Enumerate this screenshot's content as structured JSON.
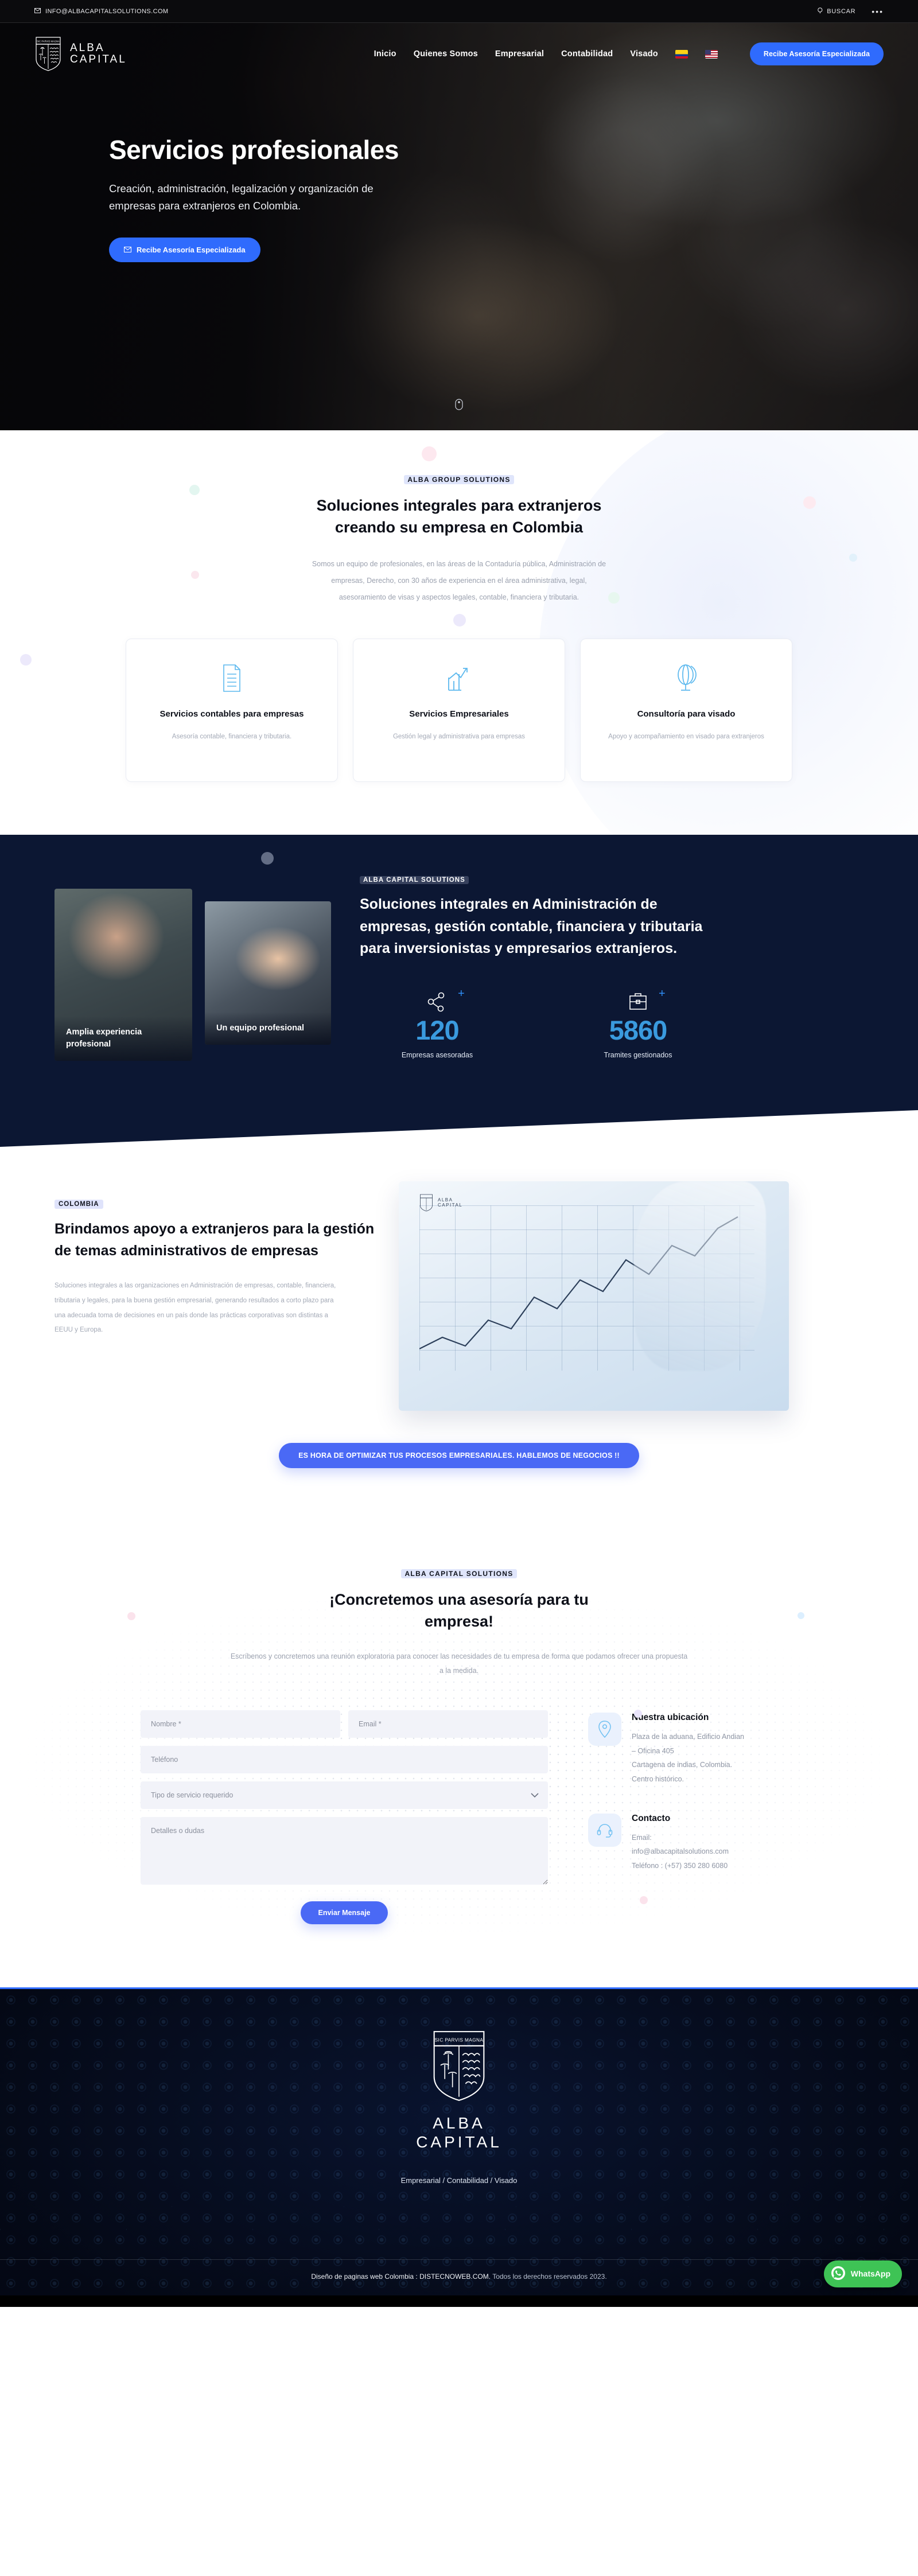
{
  "topbar": {
    "email": "INFO@ALBACAPITALSOLUTIONS.COM",
    "search_label": "BUSCAR",
    "more_label": "•••"
  },
  "brand": {
    "motto": "SIC PARVIS MAGNA",
    "line1": "ALBA",
    "line2": "CAPITAL"
  },
  "nav": {
    "items": [
      {
        "label": "Inicio"
      },
      {
        "label": "Quienes Somos"
      },
      {
        "label": "Empresarial"
      },
      {
        "label": "Contabilidad"
      },
      {
        "label": "Visado"
      }
    ],
    "flags": [
      {
        "name": "colombia-flag"
      },
      {
        "name": "usa-flag"
      }
    ],
    "cta": "Recibe Asesoría Especializada"
  },
  "hero": {
    "title": "Servicios profesionales",
    "subtitle": "Creación, administración, legalización y organización de empresas para extranjeros en Colombia.",
    "button": "Recibe Asesoría Especializada"
  },
  "solutions": {
    "eyebrow": "ALBA GROUP SOLUTIONS",
    "title": "Soluciones integrales para extranjeros creando su empresa en Colombia",
    "body": "Somos un equipo de profesionales, en las áreas de la Contaduría pública, Administración de empresas, Derecho, con 30 años de experiencia en el área administrativa, legal, asesoramiento de visas y aspectos legales, contable, financiera y tributaria.",
    "cards": [
      {
        "icon": "document-icon",
        "title": "Servicios contables para empresas",
        "desc": "Asesoría contable, financiera y tributaria."
      },
      {
        "icon": "bar-chart-growth-icon",
        "title": "Servicios Empresariales",
        "desc": "Gestión legal y administrativa para empresas"
      },
      {
        "icon": "globe-icon",
        "title": "Consultoría para visado",
        "desc": "Apoyo y acompañamiento en visado para extranjeros"
      }
    ]
  },
  "dark": {
    "eyebrow": "ALBA CAPITAL SOLUTIONS",
    "title": "Soluciones integrales en Administración de empresas, gestión contable, financiera y tributaria para inversionistas y empresarios extranjeros.",
    "photos": [
      {
        "caption": "Amplia experiencia profesional"
      },
      {
        "caption": "Un equipo profesional"
      }
    ],
    "stats": [
      {
        "icon": "share-network-icon",
        "plus": "+",
        "value": "120",
        "label": "Empresas asesoradas"
      },
      {
        "icon": "briefcase-icon",
        "plus": "+",
        "value": "5860",
        "label": "Tramites gestionados"
      }
    ]
  },
  "apoyo": {
    "tag": "COLOMBIA",
    "title": "Brindamos apoyo a extranjeros para la gestión de temas administrativos de empresas",
    "body": "Soluciones integrales a las organizaciones en Administración de empresas, contable, financiera, tributaria y legales, para la buena gestión empresarial, generando resultados a corto plazo para una adecuada toma de decisiones en un país donde las prácticas corporativas son distintas a EEUU y Europa.",
    "cta": "ES HORA DE OPTIMIZAR TUS PROCESOS EMPRESARIALES. HABLEMOS DE NEGOCIOS !!"
  },
  "contact": {
    "eyebrow": "ALBA CAPITAL SOLUTIONS",
    "title": "¡Concretemos una asesoría para tu empresa!",
    "body": "Escríbenos y concretemos una reunión exploratoria para conocer las necesidades de tu empresa de forma que podamos ofrecer una propuesta a la medida.",
    "form": {
      "name_placeholder": "Nombre *",
      "email_placeholder": "Email *",
      "phone_placeholder": "Teléfono",
      "service_placeholder": "Tipo de servicio requerido",
      "message_placeholder": "Detalles o dudas",
      "submit": "Enviar Mensaje"
    },
    "location": {
      "icon": "map-pin-icon",
      "heading": "Nuestra ubicación",
      "line1": "Plaza de la aduana, Edificio Andian",
      "line2": "– Oficina 405",
      "line3": "Cartagena de indias, Colombia.",
      "line4": "Centro histórico."
    },
    "contacto": {
      "icon": "headset-icon",
      "heading": "Contacto",
      "line1": "Email:",
      "line2": "info@albacapitalsolutions.com",
      "line3": "Teléfono : (+57) 350 280 6080"
    }
  },
  "footer": {
    "links": "Empresarial / Contabilidad / Visado",
    "credit_strong": "Diseño de paginas web Colombia : DISTECNOWEB.COM.",
    "credit_soft": " Todos los derechos reservados 2023.",
    "whatsapp": "WhatsApp"
  }
}
